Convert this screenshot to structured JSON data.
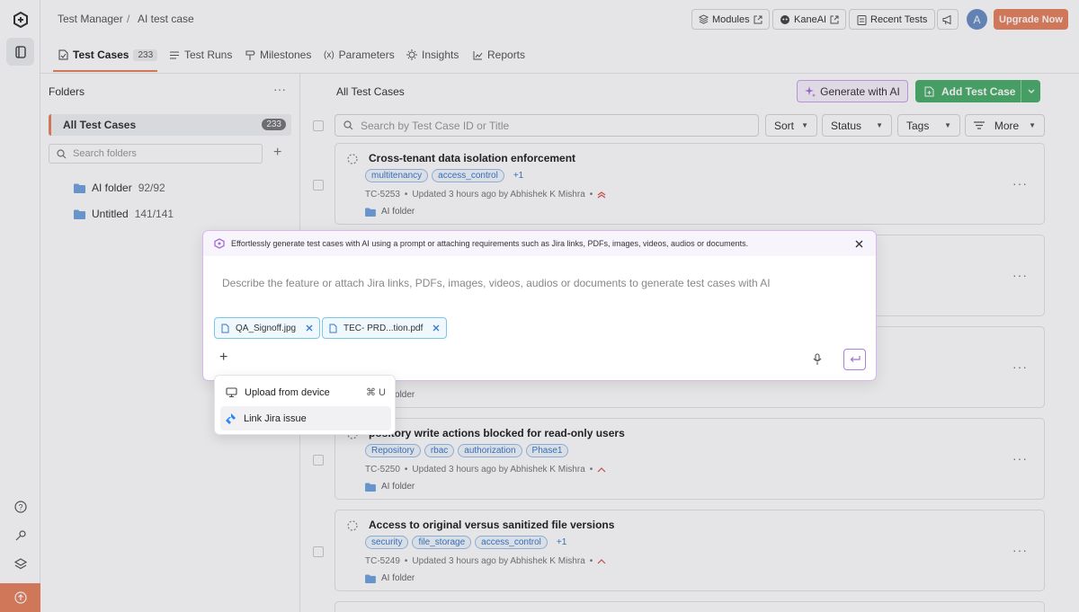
{
  "breadcrumb": {
    "root": "Test Manager",
    "separator": "/",
    "current": "AI test case"
  },
  "header_buttons": {
    "modules": "Modules",
    "kaneai": "KaneAI",
    "recent_tests": "Recent Tests",
    "avatar": "A",
    "upgrade": "Upgrade Now"
  },
  "tabs": [
    {
      "label": "Test Cases",
      "count": "233",
      "icon": "test-case-icon"
    },
    {
      "label": "Test Runs",
      "icon": "test-runs-icon"
    },
    {
      "label": "Milestones",
      "icon": "milestone-icon"
    },
    {
      "label": "Parameters",
      "icon": "parameters-icon"
    },
    {
      "label": "Insights",
      "icon": "insights-icon"
    },
    {
      "label": "Reports",
      "icon": "reports-icon"
    }
  ],
  "folders": {
    "title": "Folders",
    "all_label": "All Test Cases",
    "all_count": "233",
    "search_placeholder": "Search folders",
    "items": [
      {
        "name": "AI folder",
        "count": "92/92"
      },
      {
        "name": "Untitled",
        "count": "141/141"
      }
    ]
  },
  "main": {
    "title": "All Test Cases",
    "generate_ai": "Generate with AI",
    "add_test_case": "Add Test Case",
    "search_placeholder": "Search by Test Case ID or Title",
    "filters": {
      "sort": "Sort",
      "status": "Status",
      "tags": "Tags",
      "more": "More"
    }
  },
  "cards": [
    {
      "title": "Cross-tenant data isolation enforcement",
      "tags": [
        "multitenancy",
        "access_control"
      ],
      "more": "+1",
      "id": "TC-5253",
      "updated": "Updated 3 hours ago by Abhishek K Mishra",
      "folder": "AI folder",
      "priority": "high"
    },
    {
      "title": "",
      "tags": [],
      "more": "",
      "id": "",
      "updated": "",
      "folder": "",
      "priority": ""
    },
    {
      "title": "",
      "tags": [],
      "more": "",
      "id": "",
      "updated": "",
      "folder": "AI folder",
      "priority": ""
    },
    {
      "title": "Repository write actions blocked for read-only users",
      "title_visible": "pository write actions blocked for read-only users",
      "tags": [
        "Repository",
        "rbac",
        "authorization",
        "Phase1"
      ],
      "more": "",
      "id": "TC-5250",
      "updated": "Updated 3 hours ago by Abhishek K Mishra",
      "folder": "AI folder",
      "priority": "medium"
    },
    {
      "title": "Access to original versus sanitized file versions",
      "tags": [
        "security",
        "file_storage",
        "access_control"
      ],
      "more": "+1",
      "id": "TC-5249",
      "updated": "Updated 3 hours ago by Abhishek K Mishra",
      "folder": "AI folder",
      "priority": "medium"
    }
  ],
  "ai_modal": {
    "banner": "Effortlessly generate test cases with AI using a prompt or attaching requirements such as Jira links, PDFs, images, videos, audios or documents.",
    "placeholder": "Describe the feature or attach Jira links, PDFs, images, videos, audios or documents to generate test cases with AI",
    "attachments": [
      "QA_Signoff.jpg",
      "TEC- PRD...tion.pdf"
    ]
  },
  "attach_menu": {
    "items": [
      {
        "label": "Upload from device",
        "shortcut": "⌘ U"
      },
      {
        "label": "Link Jira issue",
        "shortcut": ""
      }
    ]
  },
  "colors": {
    "accent": "#e8825f",
    "ai_purple": "#a46bd6",
    "success": "#4caf6a",
    "tag_blue": "#3a78c9"
  }
}
